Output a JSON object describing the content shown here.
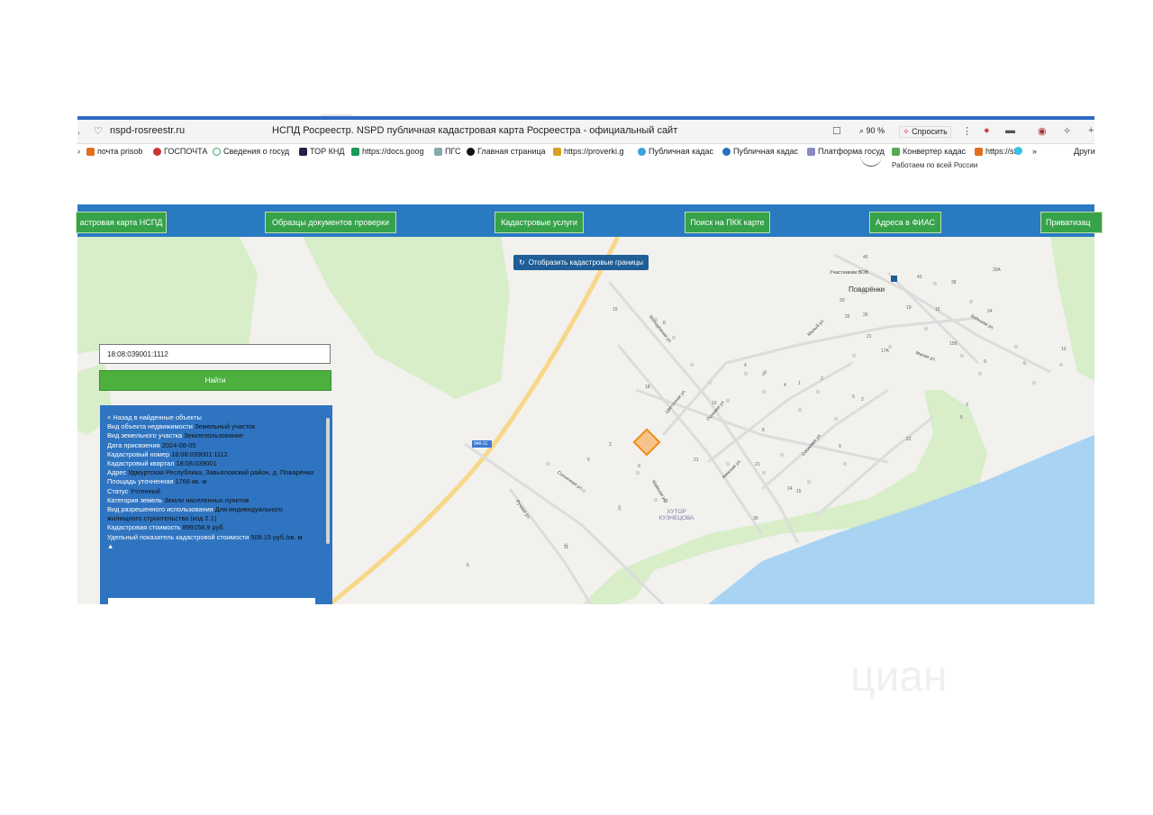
{
  "browser": {
    "url": "nspd-rosreestr.ru",
    "page_title": "НСПД Росреестр. NSPD публичная кадастровая карта Росреестра - официальный сайт",
    "zoom": "90 %",
    "ask": "Спросить",
    "bookmarks": [
      "почта prisob",
      "ГОСПОЧТА",
      "Сведения о госуд",
      "ТОР КНД",
      "https://docs.goog",
      "ПГС",
      "Главная страница",
      "https://proverki.g",
      "Публичная кадас",
      "Публичная кадас",
      "Платформа госуд",
      "Конвертер кадас",
      "https://st",
      "»",
      "Други"
    ],
    "colors": {
      "accent": "#2f6cc4"
    }
  },
  "site": {
    "subtitle": "Работаем по всей России",
    "nav": [
      "астровая карта НСПД",
      "Образцы документов проверки",
      "Кадастровые услуги",
      "Поиск на ПКК карте",
      "Адреса в ФИАС",
      "Приватизац"
    ],
    "colors": {
      "nav_bg": "#2a7ac2",
      "button": "#36a24a"
    }
  },
  "map": {
    "show_borders_button": "Отобразить кадастровые границы",
    "search_value": "18:08:039001:1112",
    "find_button": "Найти",
    "road_badge": "94К-11",
    "labels": {
      "village": "Поварёнки",
      "khutor": "ХУТОР КУЗНЕЦОВА",
      "memorial": "Участникам ВОВ",
      "streets": [
        "Молодёжная ул.",
        "Цветочная ул.",
        "Полевая ул.",
        "Солнечная ул.",
        "Ручная ул.",
        "Майская ул.",
        "Камская ул.",
        "Сосновая ул.",
        "Большая ул.",
        "Малая ул.",
        "Малый ул."
      ]
    },
    "house_numbers": [
      "15",
      "8",
      "18",
      "3",
      "4",
      "2",
      "6",
      "9",
      "12",
      "7",
      "11",
      "6",
      "10",
      "21",
      "21",
      "24",
      "15",
      "30",
      "5",
      "9",
      "2",
      "1",
      "4",
      "5",
      "3",
      "8",
      "46",
      "42",
      "38",
      "25",
      "26",
      "15",
      "19",
      "24",
      "21",
      "17А",
      "20",
      "15Б",
      "10",
      "5",
      "9",
      "33А",
      "22",
      "2",
      "3"
    ]
  },
  "info": {
    "back_link": "< Назад в найденные объекты",
    "fields": [
      {
        "label": "Вид объекта недвижимости",
        "value": "Земельный участок"
      },
      {
        "label": "Вид земельного участка",
        "value": "Землепользование"
      },
      {
        "label": "Дата присвоения",
        "value": "2024-08-05"
      },
      {
        "label": "Кадастровый номер",
        "value": "18:08:039001:1112"
      },
      {
        "label": "Кадастровый квартал",
        "value": "18:08:039001"
      },
      {
        "label": "Адрес",
        "value": "Удмуртская Республика, Завьяловский район, д. Поварёнки"
      },
      {
        "label": "Площадь уточненная",
        "value": "1766 кв. м"
      },
      {
        "label": "Статус",
        "value": "Учтенный"
      },
      {
        "label": "Категория земель",
        "value": "Земли населенных пунктов"
      },
      {
        "label": "Вид разрешенного использования",
        "value": "Для индивидуального жилищного строительства (код 2.1)"
      },
      {
        "label": "Кадастровая стоимость",
        "value": "899158.9 руб."
      },
      {
        "label": "Удельный показатель кадастровой стоимости",
        "value": "509.15 руб./кв. м"
      }
    ],
    "caret": "▲"
  },
  "watermark": "циан"
}
